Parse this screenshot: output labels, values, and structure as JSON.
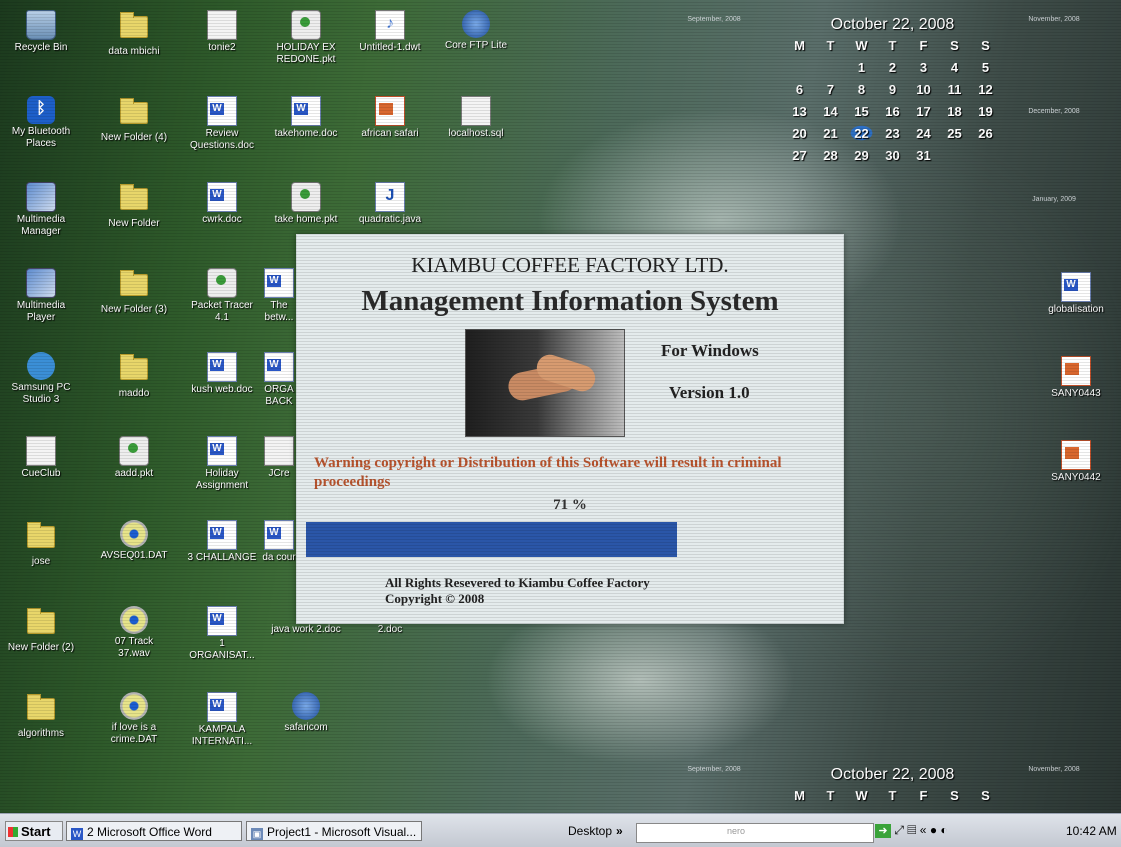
{
  "desktop": {
    "icons": [
      {
        "label": "Recycle Bin",
        "icon": "recycle-bin-icon"
      },
      {
        "label": "data mbichi",
        "icon": "folder-icon"
      },
      {
        "label": "tonie2",
        "icon": "generic-file-icon"
      },
      {
        "label": "HOLIDAY EX REDONE.pkt",
        "icon": "packet-file-icon"
      },
      {
        "label": "Untitled-1.dwt",
        "icon": "dreamweaver-file-icon"
      },
      {
        "label": "Core FTP Lite",
        "icon": "ftp-icon"
      },
      {
        "label": "My Bluetooth Places",
        "icon": "bluetooth-icon"
      },
      {
        "label": "New Folder (4)",
        "icon": "folder-icon"
      },
      {
        "label": "Review Questions.doc",
        "icon": "word-doc-icon"
      },
      {
        "label": "takehome.doc",
        "icon": "word-doc-icon"
      },
      {
        "label": "african safari",
        "icon": "powerpoint-icon"
      },
      {
        "label": "localhost.sql",
        "icon": "generic-file-icon"
      },
      {
        "label": "Multimedia Manager",
        "icon": "multimedia-icon"
      },
      {
        "label": "New Folder",
        "icon": "folder-icon"
      },
      {
        "label": "cwrk.doc",
        "icon": "word-doc-icon"
      },
      {
        "label": "take home.pkt",
        "icon": "packet-file-icon"
      },
      {
        "label": "quadratic.java",
        "icon": "java-file-icon"
      },
      {
        "label": "Multimedia Player",
        "icon": "multimedia-icon"
      },
      {
        "label": "New Folder (3)",
        "icon": "folder-icon"
      },
      {
        "label": "Packet Tracer 4.1",
        "icon": "packet-tracer-icon"
      },
      {
        "label": "The betw...",
        "icon": "word-doc-icon"
      },
      {
        "label": "Samsung PC Studio 3",
        "icon": "samsung-icon"
      },
      {
        "label": "maddo",
        "icon": "folder-icon"
      },
      {
        "label": "kush web.doc",
        "icon": "word-doc-icon"
      },
      {
        "label": "ORGA BACK",
        "icon": "word-doc-icon"
      },
      {
        "label": "CueClub",
        "icon": "cueclub-icon"
      },
      {
        "label": "aadd.pkt",
        "icon": "packet-file-icon"
      },
      {
        "label": "Holiday Assignment",
        "icon": "word-doc-icon"
      },
      {
        "label": "JCre",
        "icon": "generic-file-icon"
      },
      {
        "label": "jose",
        "icon": "folder-icon"
      },
      {
        "label": "AVSEQ01.DAT",
        "icon": "media-cd-icon"
      },
      {
        "label": "3 CHALLANGE",
        "icon": "word-doc-icon"
      },
      {
        "label": "da cour",
        "icon": "word-doc-icon"
      },
      {
        "label": "New Folder (2)",
        "icon": "folder-icon"
      },
      {
        "label": "07 Track 37.wav",
        "icon": "media-player-icon"
      },
      {
        "label": "1 ORGANISAT...",
        "icon": "word-doc-icon"
      },
      {
        "label": "java work 2.doc",
        "icon": "word-doc-icon"
      },
      {
        "label": "2.doc",
        "icon": "word-doc-icon"
      },
      {
        "label": "algorithms",
        "icon": "folder-icon"
      },
      {
        "label": "if love is a crime.DAT",
        "icon": "media-cd-icon"
      },
      {
        "label": "KAMPALA INTERNATI...",
        "icon": "word-doc-icon"
      },
      {
        "label": "safaricom",
        "icon": "safaricom-icon"
      },
      {
        "label": "globalisation",
        "icon": "word-doc-icon"
      },
      {
        "label": "SANY0443",
        "icon": "image-file-icon"
      },
      {
        "label": "SANY0442",
        "icon": "image-file-icon"
      }
    ]
  },
  "calendar_top": {
    "title": "October 22, 2008",
    "weekdays": [
      "M",
      "T",
      "W",
      "T",
      "F",
      "S",
      "S"
    ],
    "weeks": [
      [
        "",
        "",
        "1",
        "2",
        "3",
        "4",
        "5"
      ],
      [
        "6",
        "7",
        "8",
        "9",
        "10",
        "11",
        "12"
      ],
      [
        "13",
        "14",
        "15",
        "16",
        "17",
        "18",
        "19"
      ],
      [
        "20",
        "21",
        "22",
        "23",
        "24",
        "25",
        "26"
      ],
      [
        "27",
        "28",
        "29",
        "30",
        "31",
        "",
        ""
      ]
    ],
    "today": "22"
  },
  "calendar_bottom": {
    "title": "October 22, 2008",
    "weekdays": [
      "M",
      "T",
      "W",
      "T",
      "F",
      "S",
      "S"
    ]
  },
  "mini_calendars": {
    "september": "September, 2008",
    "november": "November, 2008",
    "december": "December, 2008",
    "january": "January, 2009"
  },
  "splash": {
    "company": "KIAMBU COFFEE FACTORY LTD.",
    "title": "Management Information System",
    "platform": "For Windows",
    "version": "Version 1.0",
    "warning": "Warning copyright or Distribution of this Software will result in criminal proceedings",
    "progress_label": "71 %",
    "progress": 0.71,
    "rights_line1": "All Rights Resevered to Kiambu Coffee Factory",
    "rights_line2": "Copyright © 2008"
  },
  "taskbar": {
    "start_label": "Start",
    "buttons": [
      {
        "label": "2 Microsoft Office Word"
      },
      {
        "label": "Project1 - Microsoft Visual..."
      }
    ],
    "desktop_label": "Desktop",
    "chevron": "»",
    "nero_label": "nero",
    "clock": "10:42 AM"
  },
  "colors": {
    "progress_fill": "#2a56a8",
    "warning_text": "#b8542e",
    "dialog_bg": "#e4ebec"
  }
}
